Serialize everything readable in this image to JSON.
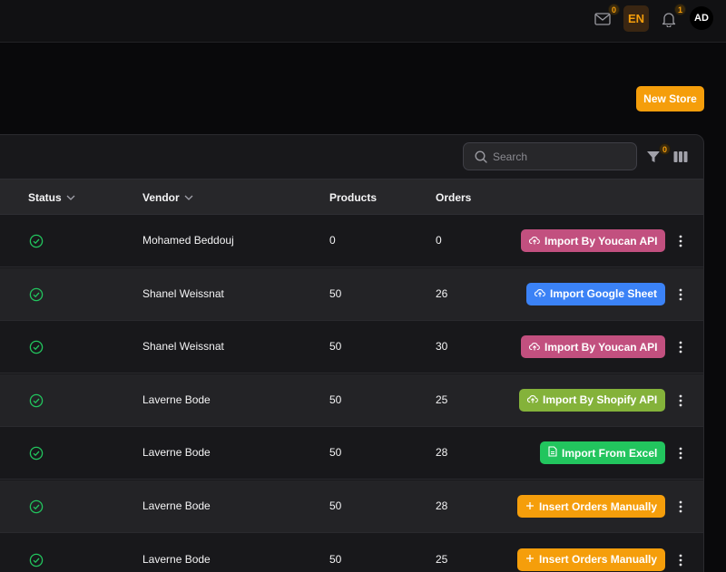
{
  "topbar": {
    "mail_count": "0",
    "language": "EN",
    "notification_count": "1",
    "avatar_initials": "AD"
  },
  "page": {
    "new_store_label": "New Store"
  },
  "toolbar": {
    "search_placeholder": "Search",
    "filter_count": "0"
  },
  "table": {
    "headers": {
      "status": "Status",
      "vendor": "Vendor",
      "products": "Products",
      "orders": "Orders"
    },
    "rows": [
      {
        "vendor": "Mohamed Beddouj",
        "products": "0",
        "orders": "0",
        "action": "Import By Youcan API",
        "action_color": "#c2507f",
        "action_icon": "cloud-upload"
      },
      {
        "vendor": "Shanel Weissnat",
        "products": "50",
        "orders": "26",
        "action": "Import Google Sheet",
        "action_color": "#3b82f6",
        "action_icon": "cloud-upload"
      },
      {
        "vendor": "Shanel Weissnat",
        "products": "50",
        "orders": "30",
        "action": "Import By Youcan API",
        "action_color": "#c2507f",
        "action_icon": "cloud-upload"
      },
      {
        "vendor": "Laverne Bode",
        "products": "50",
        "orders": "25",
        "action": "Import By Shopify API",
        "action_color": "#84b23a",
        "action_icon": "cloud-upload"
      },
      {
        "vendor": "Laverne Bode",
        "products": "50",
        "orders": "28",
        "action": "Import From Excel",
        "action_color": "#22c55e",
        "action_icon": "file"
      },
      {
        "vendor": "Laverne Bode",
        "products": "50",
        "orders": "28",
        "action": "Insert Orders Manually",
        "action_color": "#f59e0b",
        "action_icon": "plus"
      },
      {
        "vendor": "Laverne Bode",
        "products": "50",
        "orders": "25",
        "action": "Insert Orders Manually",
        "action_color": "#f59e0b",
        "action_icon": "plus"
      }
    ]
  },
  "colors": {
    "accent": "#f59e0b",
    "status_active": "#22c55e"
  }
}
